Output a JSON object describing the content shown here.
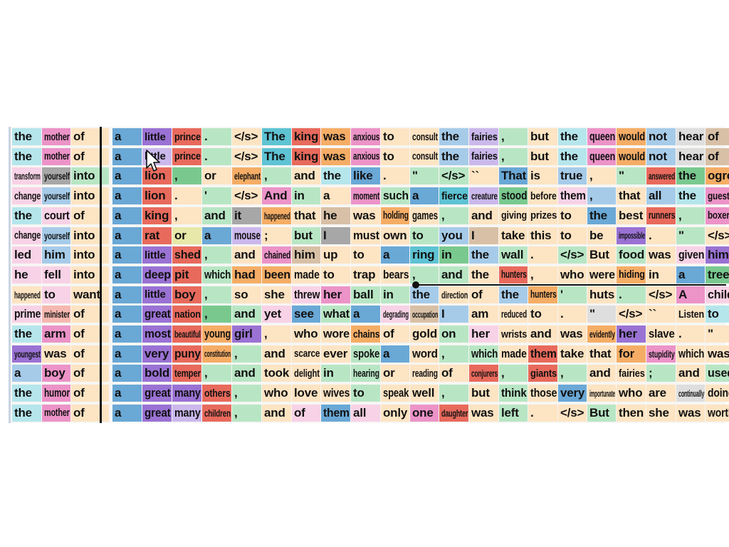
{
  "palette": {
    "1": "#6aa8d6",
    "2": "#a6cbe9",
    "3": "#e86a5c",
    "4": "#f6b8b0",
    "5": "#79c98f",
    "6": "#b8e6c4",
    "7": "#f5ad66",
    "8": "#fde4c3",
    "9": "#9a72d4",
    "10": "#cbb8ec",
    "11": "#a8835a",
    "12": "#d8c0a6",
    "13": "#ec93c8",
    "14": "#f8d2e6",
    "15": "#a7a7a7",
    "16": "#dedede",
    "17": "#c7c95a",
    "18": "#e8e8a8",
    "19": "#5ec3d3",
    "20": "#b5e6ec"
  },
  "columns": [
    {
      "w": 42
    },
    {
      "w": 41
    },
    {
      "w": 54
    },
    {
      "w": 42
    },
    {
      "w": 42
    },
    {
      "w": 42
    },
    {
      "w": 42
    },
    {
      "w": 42
    },
    {
      "w": 42
    },
    {
      "w": 41
    },
    {
      "w": 42
    },
    {
      "w": 42
    },
    {
      "w": 41
    },
    {
      "w": 41
    },
    {
      "w": 42
    },
    {
      "w": 42
    },
    {
      "w": 41
    },
    {
      "w": 42
    },
    {
      "w": 41
    },
    {
      "w": 41
    },
    {
      "w": 42
    },
    {
      "w": 42
    },
    {
      "w": 41
    },
    {
      "w": 42
    }
  ],
  "rows": [
    [
      "the",
      "mother",
      "of",
      "a",
      "little",
      "prince",
      ".",
      "</s>",
      "The",
      "king",
      "was",
      "anxious",
      "to",
      "consult",
      "the",
      "fairies",
      ",",
      "but",
      "the",
      "queen",
      "would",
      "not",
      "hear",
      "of"
    ],
    [
      "the",
      "mother",
      "of",
      "a",
      "little",
      "prince",
      ".",
      "</s>",
      "The",
      "king",
      "was",
      "anxious",
      "to",
      "consult",
      "the",
      "fairies",
      ",",
      "but",
      "the",
      "queen",
      "would",
      "not",
      "hear",
      "of"
    ],
    [
      "transform",
      "yourself",
      "into",
      "a",
      "lion",
      ",",
      "or",
      "elephant",
      ",",
      "and",
      "the",
      "like",
      ".",
      "\"",
      "</s>",
      "``",
      "That",
      "is",
      "true",
      ",",
      "\"",
      "answered",
      "the",
      "ogre"
    ],
    [
      "change",
      "yourself",
      "into",
      "a",
      "lion",
      ".",
      "'",
      "</s>",
      "And",
      "in",
      "a",
      "moment",
      "such",
      "a",
      "fierce",
      "creature",
      "stood",
      "before",
      "them",
      ",",
      "that",
      "all",
      "the",
      "guests"
    ],
    [
      "the",
      "court",
      "of",
      "a",
      "king",
      ",",
      "and",
      "it",
      "happened",
      "that",
      "he",
      "was",
      "holding",
      "games",
      ",",
      "and",
      "giving",
      "prizes",
      "to",
      "the",
      "best",
      "runners",
      ",",
      "boxers"
    ],
    [
      "change",
      "yourself",
      "into",
      "a",
      "rat",
      "or",
      "a",
      "mouse",
      ";",
      "but",
      "I",
      "must",
      "own",
      "to",
      "you",
      "I",
      "take",
      "this",
      "to",
      "be",
      "impossible",
      ".",
      "\"",
      "</s>"
    ],
    [
      "led",
      "him",
      "into",
      "a",
      "little",
      "shed",
      ",",
      "and",
      "chained",
      "him",
      "up",
      "to",
      "a",
      "ring",
      "in",
      "the",
      "wall",
      ".",
      "</s>",
      "But",
      "food",
      "was",
      "given",
      "him"
    ],
    [
      "he",
      "fell",
      "into",
      "a",
      "deep",
      "pit",
      "which",
      "had",
      "been",
      "made",
      "to",
      "trap",
      "bears",
      ",",
      "and",
      "the",
      "hunters",
      ",",
      "who",
      "were",
      "hiding",
      "in",
      "a",
      "tree"
    ],
    [
      "happened",
      "to",
      "want",
      "a",
      "little",
      "boy",
      ",",
      "so",
      "she",
      "threw",
      "her",
      "ball",
      "in",
      "the",
      "direction",
      "of",
      "the",
      "hunters",
      "'",
      "huts",
      ".",
      "</s>",
      "A",
      "child"
    ],
    [
      "prime",
      "minister",
      "of",
      "a",
      "great",
      "nation",
      ",",
      "and",
      "yet",
      "see",
      "what",
      "a",
      "degrading",
      "occupation",
      "I",
      "am",
      "reduced",
      "to",
      ".",
      "\"",
      "</s>",
      "``",
      "Listen",
      "to"
    ],
    [
      "the",
      "arm",
      "of",
      "a",
      "most",
      "beautiful",
      "young",
      "girl",
      ",",
      "who",
      "wore",
      "chains",
      "of",
      "gold",
      "on",
      "her",
      "wrists",
      "and",
      "was",
      "evidently",
      "her",
      "slave",
      ".",
      "\""
    ],
    [
      "youngest",
      "was",
      "of",
      "a",
      "very",
      "puny",
      "constitution",
      ",",
      "and",
      "scarce",
      "ever",
      "spoke",
      "a",
      "word",
      ",",
      "which",
      "made",
      "them",
      "take",
      "that",
      "for",
      "stupidity",
      "which",
      "was"
    ],
    [
      "a",
      "boy",
      "of",
      "a",
      "bold",
      "temper",
      ",",
      "and",
      "took",
      "delight",
      "in",
      "hearing",
      "or",
      "reading",
      "of",
      "conjurers",
      ",",
      "giants",
      ",",
      "and",
      "fairies",
      ";",
      "and",
      "used"
    ],
    [
      "the",
      "humor",
      "of",
      "a",
      "great",
      "many",
      "others",
      ",",
      "who",
      "love",
      "wives",
      "to",
      "speak",
      "well",
      ",",
      "but",
      "think",
      "those",
      "very",
      "importunate",
      "who",
      "are",
      "continually",
      "doing"
    ],
    [
      "the",
      "mother",
      "of",
      "a",
      "great",
      "many",
      "children",
      ",",
      "and",
      "of",
      "them",
      "all",
      "only",
      "one",
      "daughter",
      "was",
      "left",
      ".",
      "</s>",
      "But",
      "then",
      "she",
      "was",
      "worth"
    ]
  ],
  "colors": [
    [
      20,
      13,
      8,
      1,
      9,
      3,
      6,
      8,
      19,
      3,
      7,
      13,
      8,
      8,
      2,
      10,
      6,
      8,
      20,
      13,
      7,
      2,
      16,
      12
    ],
    [
      20,
      13,
      8,
      1,
      10,
      3,
      6,
      8,
      19,
      3,
      7,
      13,
      8,
      8,
      2,
      10,
      6,
      8,
      20,
      13,
      7,
      2,
      16,
      12
    ],
    [
      14,
      15,
      6,
      1,
      3,
      5,
      8,
      7,
      6,
      8,
      20,
      1,
      8,
      6,
      6,
      8,
      1,
      8,
      2,
      8,
      6,
      3,
      5,
      7
    ],
    [
      14,
      2,
      8,
      1,
      3,
      8,
      6,
      8,
      13,
      6,
      8,
      13,
      6,
      1,
      19,
      10,
      5,
      8,
      14,
      2,
      8,
      2,
      20,
      13
    ],
    [
      20,
      14,
      8,
      1,
      3,
      8,
      6,
      15,
      7,
      8,
      12,
      8,
      7,
      8,
      6,
      8,
      8,
      8,
      8,
      1,
      8,
      3,
      6,
      13
    ],
    [
      14,
      2,
      8,
      1,
      3,
      18,
      1,
      10,
      8,
      6,
      15,
      8,
      8,
      6,
      2,
      12,
      8,
      8,
      8,
      8,
      9,
      8,
      6,
      8
    ],
    [
      14,
      2,
      8,
      1,
      9,
      3,
      6,
      8,
      13,
      12,
      8,
      8,
      1,
      19,
      5,
      2,
      6,
      8,
      6,
      8,
      6,
      8,
      14,
      9
    ],
    [
      14,
      14,
      8,
      1,
      9,
      3,
      6,
      7,
      7,
      8,
      8,
      8,
      8,
      6,
      6,
      8,
      3,
      8,
      8,
      8,
      7,
      8,
      1,
      5
    ],
    [
      8,
      14,
      8,
      1,
      9,
      3,
      6,
      8,
      8,
      14,
      13,
      6,
      6,
      2,
      8,
      8,
      2,
      7,
      6,
      8,
      6,
      8,
      13,
      14
    ],
    [
      14,
      4,
      8,
      1,
      9,
      3,
      5,
      6,
      14,
      1,
      6,
      1,
      14,
      12,
      2,
      8,
      8,
      8,
      8,
      16,
      8,
      8,
      8,
      20
    ],
    [
      20,
      13,
      8,
      1,
      9,
      3,
      7,
      9,
      8,
      8,
      8,
      7,
      8,
      8,
      6,
      14,
      8,
      8,
      8,
      7,
      9,
      8,
      8,
      8
    ],
    [
      9,
      8,
      8,
      1,
      9,
      3,
      7,
      6,
      8,
      8,
      8,
      6,
      1,
      8,
      6,
      6,
      8,
      3,
      8,
      8,
      7,
      13,
      8,
      8
    ],
    [
      2,
      13,
      8,
      1,
      9,
      3,
      6,
      6,
      8,
      8,
      6,
      6,
      8,
      8,
      8,
      3,
      6,
      3,
      6,
      8,
      8,
      6,
      8,
      6
    ],
    [
      20,
      13,
      8,
      1,
      9,
      9,
      3,
      6,
      8,
      8,
      8,
      6,
      8,
      8,
      6,
      8,
      6,
      8,
      1,
      8,
      8,
      8,
      16,
      8
    ],
    [
      20,
      13,
      8,
      1,
      9,
      10,
      3,
      6,
      8,
      14,
      1,
      14,
      8,
      13,
      3,
      8,
      6,
      8,
      8,
      6,
      8,
      8,
      8,
      8
    ]
  ]
}
